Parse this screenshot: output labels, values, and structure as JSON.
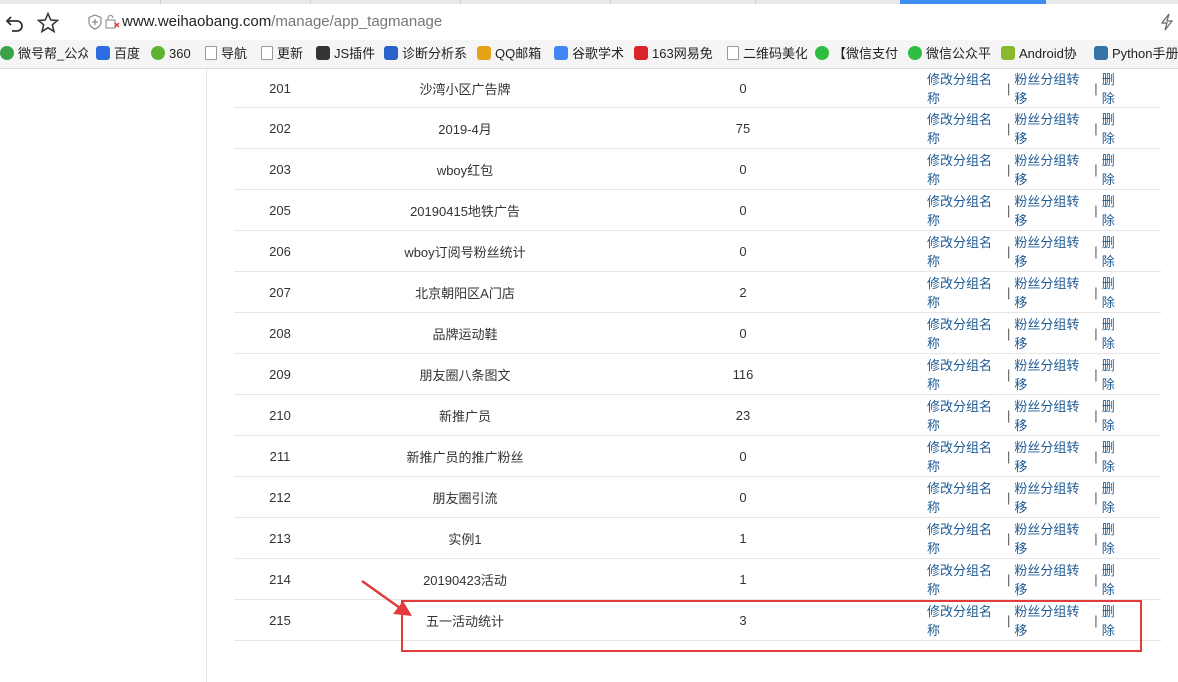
{
  "browser": {
    "url_host": "www.weihaobang.com",
    "url_path": "/manage/app_tagmanage",
    "bookmarks": [
      {
        "label": "微号帮_公众",
        "icon": "weihaobang-icon",
        "color": "#3aa34a"
      },
      {
        "label": "百度",
        "icon": "baidu-paw-icon",
        "color": "#2b6de0"
      },
      {
        "label": "360",
        "icon": "360-icon",
        "color": "#5bb32e"
      },
      {
        "label": "导航",
        "icon": "page-icon",
        "color": "#999999"
      },
      {
        "label": "更新",
        "icon": "page-icon",
        "color": "#999999"
      },
      {
        "label": "JS插件",
        "icon": "js-icon",
        "color": "#333333"
      },
      {
        "label": "诊断分析系",
        "icon": "diagnose-icon",
        "color": "#2a62c9"
      },
      {
        "label": "QQ邮箱",
        "icon": "qq-mail-icon",
        "color": "#e8a21a"
      },
      {
        "label": "谷歌学术",
        "icon": "google-icon",
        "color": "#4285f4"
      },
      {
        "label": "163网易免",
        "icon": "netease-icon",
        "color": "#d8262b"
      },
      {
        "label": "二维码美化",
        "icon": "page-icon",
        "color": "#999999"
      },
      {
        "label": "【微信支付",
        "icon": "wechat-icon",
        "color": "#2dbe41"
      },
      {
        "label": "微信公众平",
        "icon": "wechat-icon",
        "color": "#2dbe41"
      },
      {
        "label": "Android协",
        "icon": "android-icon",
        "color": "#8ab82e"
      },
      {
        "label": "Python手册",
        "icon": "python-icon",
        "color": "#3572a5"
      }
    ]
  },
  "table": {
    "op_labels": {
      "rename": "修改分组名称",
      "transfer": "粉丝分组转移",
      "delete": "删除",
      "separator": "|"
    },
    "rows": [
      {
        "id": "201",
        "name": "沙湾小区广告牌",
        "count": "0"
      },
      {
        "id": "202",
        "name": "2019-4月",
        "count": "75"
      },
      {
        "id": "203",
        "name": "wboy红包",
        "count": "0"
      },
      {
        "id": "205",
        "name": "20190415地铁广告",
        "count": "0"
      },
      {
        "id": "206",
        "name": "wboy订阅号粉丝统计",
        "count": "0"
      },
      {
        "id": "207",
        "name": "北京朝阳区A门店",
        "count": "2"
      },
      {
        "id": "208",
        "name": "品牌运动鞋",
        "count": "0"
      },
      {
        "id": "209",
        "name": "朋友圈八条图文",
        "count": "116"
      },
      {
        "id": "210",
        "name": "新推广员",
        "count": "23"
      },
      {
        "id": "211",
        "name": "新推广员的推广粉丝",
        "count": "0"
      },
      {
        "id": "212",
        "name": "朋友圈引流",
        "count": "0"
      },
      {
        "id": "213",
        "name": "实例1",
        "count": "1"
      },
      {
        "id": "214",
        "name": "20190423活动",
        "count": "1"
      },
      {
        "id": "215",
        "name": "五一活动统计",
        "count": "3"
      }
    ]
  },
  "annotation": {
    "color": "#e23b3b",
    "highlighted_row_id": "215"
  }
}
